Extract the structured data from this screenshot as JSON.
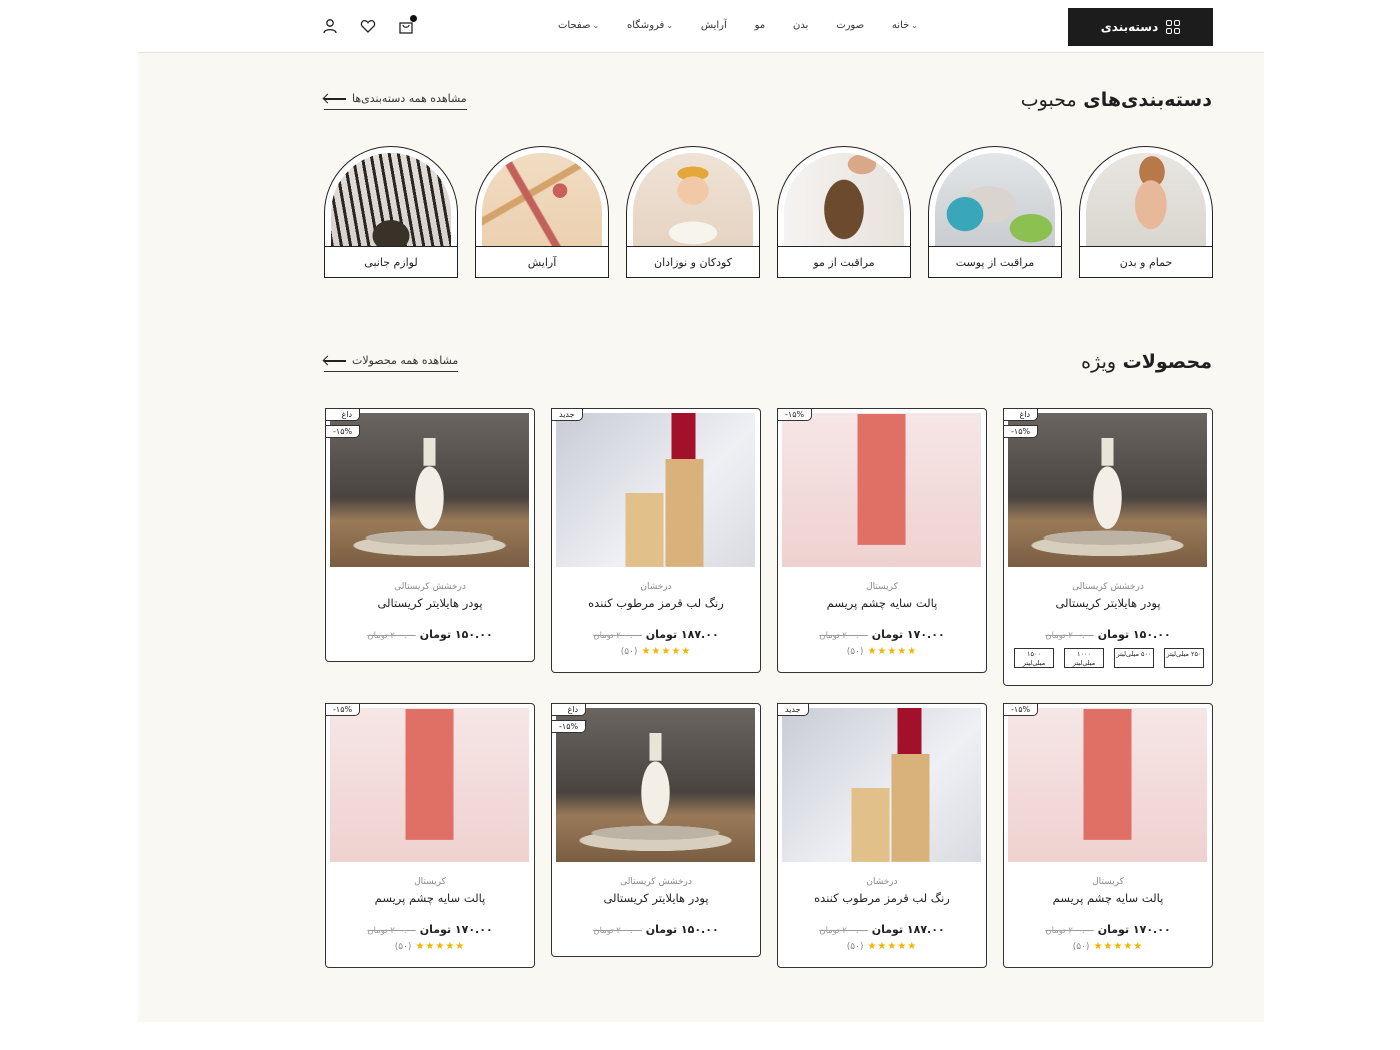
{
  "header": {
    "category_button": "دسته‌بندی",
    "nav": [
      {
        "label": "خانه",
        "dropdown": true
      },
      {
        "label": "صورت",
        "dropdown": false
      },
      {
        "label": "بدن",
        "dropdown": false
      },
      {
        "label": "مو",
        "dropdown": false
      },
      {
        "label": "آرایش",
        "dropdown": false
      },
      {
        "label": "فروشگاه",
        "dropdown": true
      },
      {
        "label": "صفحات",
        "dropdown": true
      }
    ],
    "icons": [
      "cart-icon",
      "heart-icon",
      "user-icon"
    ]
  },
  "categories_section": {
    "title_bold": "دسته‌بندی‌های",
    "title_light": "محبوب",
    "see_all": "مشاهده همه دسته‌بندی‌ها",
    "items": [
      {
        "label": "حمام و بدن"
      },
      {
        "label": "مراقبت از پوست"
      },
      {
        "label": "مراقبت از مو"
      },
      {
        "label": "کودکان و نوزادان"
      },
      {
        "label": "آرایش"
      },
      {
        "label": "لوازم جانبی"
      }
    ]
  },
  "products_section": {
    "title_bold": "محصولات",
    "title_light": "ویژه",
    "see_all": "مشاهده همه محصولات",
    "products": [
      {
        "badges": [
          "داغ",
          "۱۵%-"
        ],
        "brand": "درخشش کریستالی",
        "name": "پودر هایلایتر کریستالی",
        "price": "۱۵۰.۰۰ تومان",
        "old_price": "۲۰۰.۰۰ تومان",
        "rating": "",
        "sizes": [
          "۲۵۰ میلی‌لیتر",
          "۵۰۰ میلی‌لیتر",
          "۱۰۰۰ میلی‌لیتر",
          "۱۵۰۰ میلی‌لیتر"
        ]
      },
      {
        "badges": [
          "۱۵%-"
        ],
        "brand": "کریستال",
        "name": "پالت سایه چشم پریسم",
        "price": "۱۷۰.۰۰ تومان",
        "old_price": "۲۰۰.۰۰ تومان",
        "rating": "(۵۰)"
      },
      {
        "badges": [
          "جدید"
        ],
        "brand": "درخشان",
        "name": "رنگ لب قرمز مرطوب کننده",
        "price": "۱۸۷.۰۰ تومان",
        "old_price": "۲۰۰.۰۰ تومان",
        "rating": "(۵۰)"
      },
      {
        "badges": [
          "داغ",
          "۱۵%-"
        ],
        "brand": "درخشش کریستالی",
        "name": "پودر هایلایتر کریستالی",
        "price": "۱۵۰.۰۰ تومان",
        "old_price": "۲۰۰.۰۰ تومان",
        "rating": ""
      },
      {
        "badges": [
          "۱۵%-"
        ],
        "brand": "کریستال",
        "name": "پالت سایه چشم پریسم",
        "price": "۱۷۰.۰۰ تومان",
        "old_price": "۲۰۰.۰۰ تومان",
        "rating": "(۵۰)"
      },
      {
        "badges": [
          "جدید"
        ],
        "brand": "درخشان",
        "name": "رنگ لب قرمز مرطوب کننده",
        "price": "۱۸۷.۰۰ تومان",
        "old_price": "۲۰۰.۰۰ تومان",
        "rating": "(۵۰)"
      },
      {
        "badges": [
          "داغ",
          "۱۵%-"
        ],
        "brand": "درخشش کریستالی",
        "name": "پودر هایلایتر کریستالی",
        "price": "۱۵۰.۰۰ تومان",
        "old_price": "۲۰۰.۰۰ تومان",
        "rating": ""
      },
      {
        "badges": [
          "۱۵%-"
        ],
        "brand": "کریستال",
        "name": "پالت سایه چشم پریسم",
        "price": "۱۷۰.۰۰ تومان",
        "old_price": "۲۰۰.۰۰ تومان",
        "rating": "(۵۰)"
      }
    ]
  },
  "colors": {
    "accent": "#1c1c1c",
    "background": "#faf8f2",
    "star": "#f3b400"
  }
}
